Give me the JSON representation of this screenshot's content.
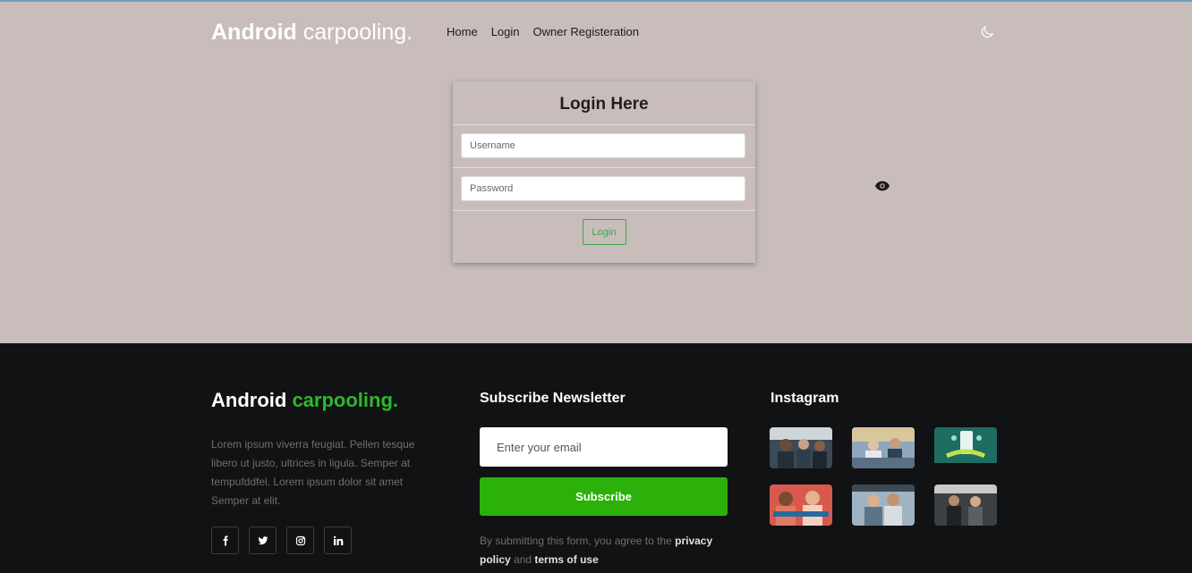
{
  "header": {
    "brand_bold": "Android",
    "brand_light": " carpooling.",
    "nav": [
      "Home",
      "Login",
      "Owner Registeration"
    ]
  },
  "login": {
    "title": "Login Here",
    "username_placeholder": "Username",
    "password_placeholder": "Password",
    "button": "Login"
  },
  "footer": {
    "brand_bold": "Android",
    "brand_green": " carpooling.",
    "description": "Lorem ipsum viverra feugiat. Pellen tesque libero ut justo, ultrices in ligula. Semper at tempufddfel. Lorem ipsum dolor sit amet Semper at elit.",
    "socials": [
      "facebook-icon",
      "twitter-icon",
      "instagram-icon",
      "linkedin-icon"
    ],
    "newsletter": {
      "title": "Subscribe Newsletter",
      "placeholder": "Enter your email",
      "button": "Subscribe",
      "terms_prefix": "By submitting this form, you agree to the ",
      "privacy": "privacy policy",
      "and": " and ",
      "terms": "terms of use"
    },
    "instagram": {
      "title": "Instagram"
    }
  },
  "colors": {
    "background": "#c8bdbb",
    "footer": "#111214",
    "accent_green": "#2bb10a"
  }
}
